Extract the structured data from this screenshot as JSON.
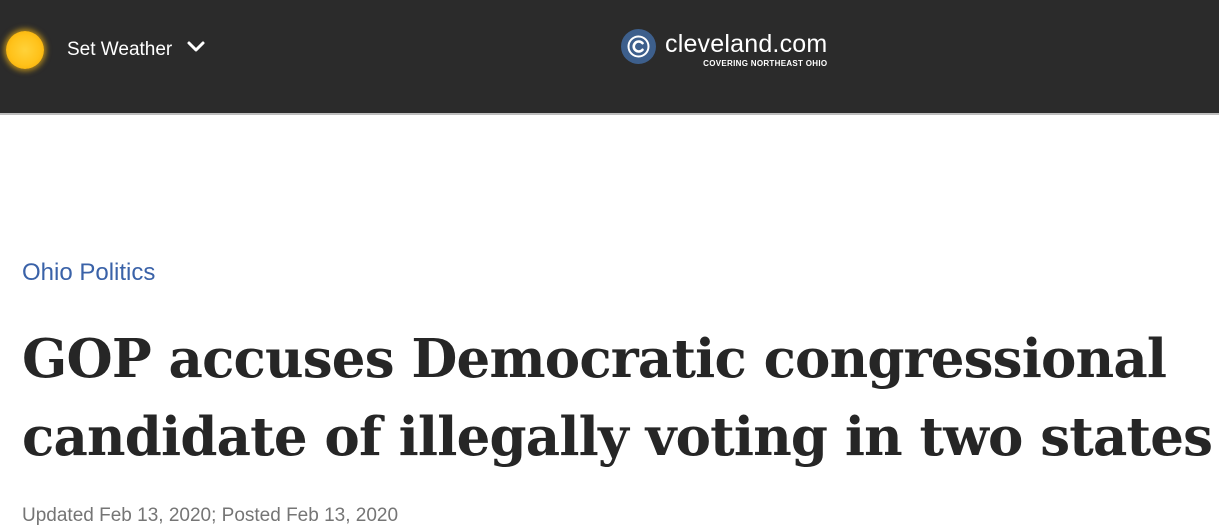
{
  "header": {
    "weather": {
      "label": "Set Weather",
      "icon": "sun-icon",
      "dropdown_icon": "chevron-down-icon"
    },
    "brand": {
      "logo_icon": "cleveland-logo-icon",
      "name": "cleveland.com",
      "tagline": "COVERING NORTHEAST OHIO"
    },
    "colors": {
      "background": "#2b2b2b",
      "logo_circle": "#3d5f8c"
    }
  },
  "article": {
    "section": "Ohio Politics",
    "headline": [
      "GOP accuses Democratic congressional",
      "candidate of illegally voting in two states"
    ],
    "timestamp": "Updated Feb 13, 2020; Posted Feb 13, 2020",
    "colors": {
      "section_link": "#3a62a8",
      "headline": "#262626",
      "timestamp": "#757575"
    }
  }
}
